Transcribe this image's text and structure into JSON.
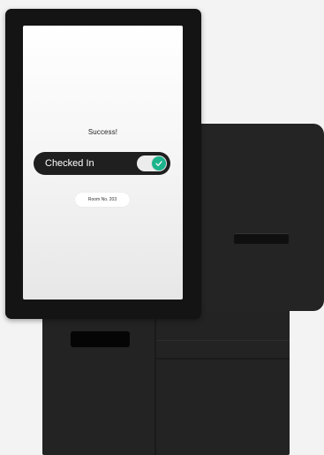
{
  "screen": {
    "success_text": "Success!",
    "checkin_label": "Checked In",
    "toggle_state": "on",
    "toggle_icon": "check-icon",
    "room_label": "Room No. 203"
  },
  "colors": {
    "toggle_accent": "#1db48c",
    "pill_background": "#1f1f1f",
    "kiosk_body": "#242424"
  }
}
